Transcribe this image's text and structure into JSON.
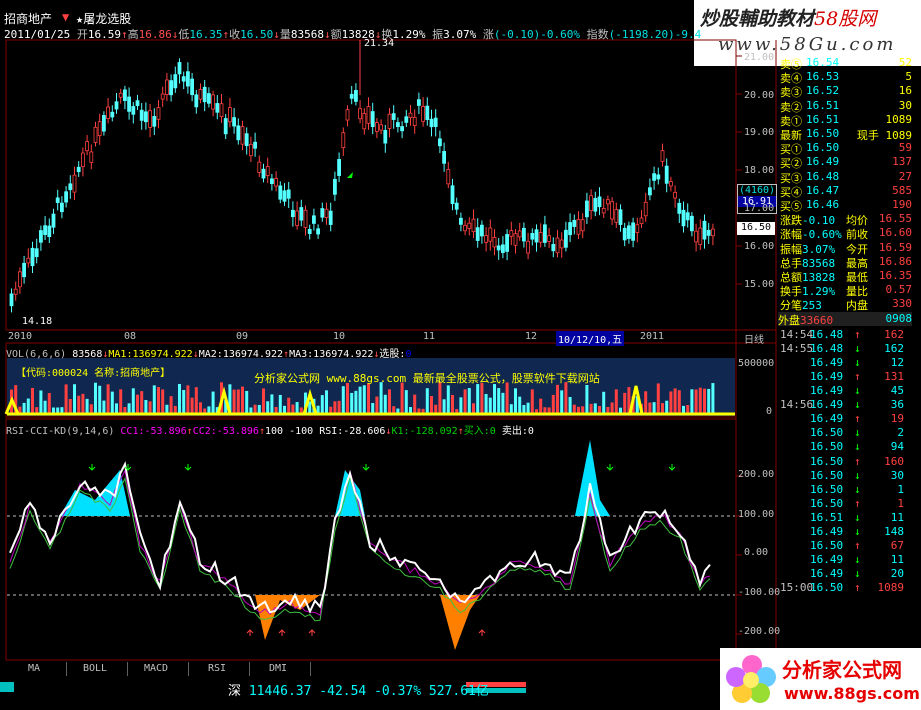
{
  "window": {
    "stock_name": "招商地产",
    "separator": "▼",
    "formula_name": "★屠龙选股"
  },
  "banner": {
    "line1_prefix": "炒股輔助教材",
    "line1_suffix": "58股网",
    "line2": "www.58Gu.com"
  },
  "quote_line": {
    "date": "2011/01/25",
    "open_label": "开",
    "open": "16.59",
    "high_label": "高",
    "high": "16.86",
    "low_label": "低",
    "low": "16.35",
    "close_label": "收",
    "close": "16.50",
    "vol_label": "量",
    "vol": "83568",
    "amt_label": "额",
    "amt": "13828",
    "turnover_label": "换",
    "turnover": "1.29%",
    "amp_label": "振",
    "amp": "3.07%",
    "chg_label": "涨",
    "chg": "(-0.10)-0.60%",
    "index_label": "指数",
    "index": "(-1198.20)-9.4"
  },
  "main_chart": {
    "high_mark": "21.34",
    "low_mark": "14.18",
    "y_ticks": [
      "21.00",
      "20.00",
      "19.00",
      "18.00",
      "17.00",
      "16.00",
      "15.00"
    ],
    "x_labels": [
      "2010",
      "08",
      "09",
      "10",
      "11",
      "12",
      "2011"
    ],
    "cursor_date": "10/12/10,五",
    "period": "日线",
    "price_box": "(4160)",
    "price_box2": "16.91",
    "last_price": "16.50",
    "up_color": "#ff4040",
    "down_color": "#54ffff"
  },
  "vol_panel": {
    "header": "VOL(6,6,6)",
    "vol": "83568",
    "ma1_label": "MA1:",
    "ma1": "136974.922",
    "ma2_label": "MA2:",
    "ma2": "136974.922",
    "ma3_label": "MA3:",
    "ma3": "136974.922",
    "pick_label": "选股:",
    "pick": "0",
    "ticks": [
      "500000",
      "0"
    ],
    "promo_code": "【代码:000024 名称:招商地产】",
    "promo_text": "分析家公式网 www.88gs.com 最新最全股票公式，股票软件下载网站"
  },
  "rsi_panel": {
    "header": "RSI-CCI-KD(9,14,6)",
    "cc1_label": "CC1:",
    "cc1": "-53.896",
    "cc2_label": "CC2:",
    "cc2": "-53.896",
    "lev1": "100",
    "lev2": "-100",
    "rsi_label": "RSI:",
    "rsi": "-28.606",
    "k1_label": "K1:",
    "k1": "-128.092",
    "buy_label": "买入:",
    "buy": "0",
    "sell_label": "卖出:",
    "sell": "0",
    "ticks": [
      "200.00",
      "100.00",
      "0.00",
      "-100.00",
      "-200.00"
    ]
  },
  "right_panel": {
    "asks": [
      {
        "label": "卖⑤",
        "price": "16.54",
        "vol": "52"
      },
      {
        "label": "卖④",
        "price": "16.53",
        "vol": "5"
      },
      {
        "label": "卖③",
        "price": "16.52",
        "vol": "16"
      },
      {
        "label": "卖②",
        "price": "16.51",
        "vol": "30"
      }
    ],
    "ask1": {
      "label": "卖①",
      "price": "16.51",
      "vol": "1089"
    },
    "last": {
      "label": "最新",
      "price": "16.50",
      "hand_label": "现手",
      "hand": "1089"
    },
    "bids": [
      {
        "label": "买①",
        "price": "16.50",
        "vol": "59"
      },
      {
        "label": "买②",
        "price": "16.49",
        "vol": "137"
      },
      {
        "label": "买③",
        "price": "16.48",
        "vol": "27"
      },
      {
        "label": "买④",
        "price": "16.47",
        "vol": "585"
      },
      {
        "label": "买⑤",
        "price": "16.46",
        "vol": "190"
      }
    ],
    "stats": [
      {
        "l1": "涨跌",
        "v1": "-0.10",
        "l2": "均价",
        "v2": "16.55"
      },
      {
        "l1": "涨幅",
        "v1": "-0.60%",
        "l2": "前收",
        "v2": "16.60"
      },
      {
        "l1": "振幅",
        "v1": "3.07%",
        "l2": "今开",
        "v2": "16.59"
      },
      {
        "l1": "总手",
        "v1": "83568",
        "l2": "最高",
        "v2": "16.86"
      },
      {
        "l1": "总额",
        "v1": "13828",
        "l2": "最低",
        "v2": "16.35"
      },
      {
        "l1": "换手",
        "v1": "1.29%",
        "l2": "量比",
        "v2": "0.57"
      },
      {
        "l1": "分笔",
        "v1": "253",
        "l2": "内盘",
        "v2": "330"
      }
    ],
    "outer_label": "外盘",
    "outer": "33660",
    "inner_label": "内盘",
    "inner": "0908",
    "ticks": [
      {
        "t": "14:54",
        "p": "16.48",
        "v": "162"
      },
      {
        "t": "14:55",
        "p": "16.48",
        "v": "162"
      },
      {
        "t": "",
        "p": "16.49",
        "v": "12"
      },
      {
        "t": "",
        "p": "16.49",
        "v": "131"
      },
      {
        "t": "",
        "p": "16.49",
        "v": "45"
      },
      {
        "t": "14:56",
        "p": "16.49",
        "v": "36"
      },
      {
        "t": "",
        "p": "16.49",
        "v": "19"
      },
      {
        "t": "",
        "p": "16.50",
        "v": "2"
      },
      {
        "t": "",
        "p": "16.50",
        "v": "94"
      },
      {
        "t": "",
        "p": "16.50",
        "v": "160"
      },
      {
        "t": "",
        "p": "16.50",
        "v": "30"
      },
      {
        "t": "",
        "p": "16.50",
        "v": "1"
      },
      {
        "t": "",
        "p": "16.50",
        "v": "1"
      },
      {
        "t": "",
        "p": "16.51",
        "v": "11"
      },
      {
        "t": "",
        "p": "16.49",
        "v": "148"
      },
      {
        "t": "",
        "p": "16.50",
        "v": "67"
      },
      {
        "t": "",
        "p": "16.49",
        "v": "11"
      },
      {
        "t": "",
        "p": "16.49",
        "v": "20"
      },
      {
        "t": "15:00",
        "p": "16.50",
        "v": "1089"
      }
    ]
  },
  "tabs": [
    "MA",
    "BOLL",
    "MACD",
    "RSI",
    "DMI"
  ],
  "status": {
    "market": "深",
    "index": "11446.37",
    "change": "-42.54",
    "pct": "-0.37%",
    "amount": "527.61亿"
  },
  "logo2": {
    "text": "分析家公式网",
    "url": "www.88gs.com"
  }
}
